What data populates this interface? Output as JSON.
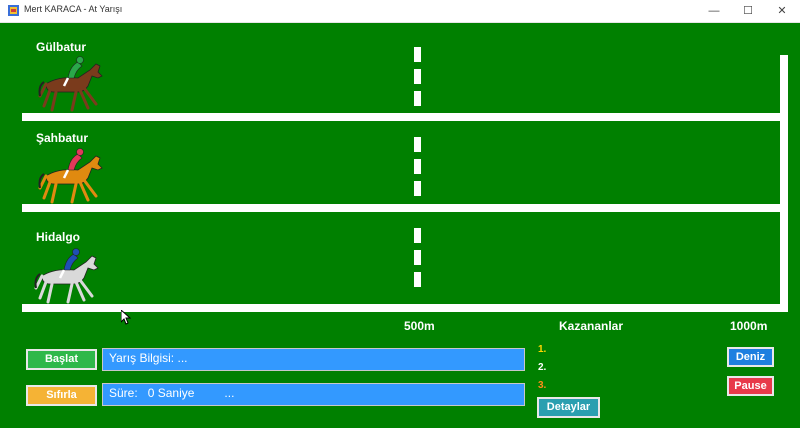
{
  "window": {
    "title": "Mert KARACA - At Yarışı",
    "min_symbol": "—",
    "max_symbol": "☐",
    "close_symbol": "✕"
  },
  "horses": [
    {
      "name": "Gülbatur",
      "jockey_color": "#2aa84a",
      "body_color": "#7a3b1c"
    },
    {
      "name": "Şahbatur",
      "jockey_color": "#e23a5a",
      "body_color": "#e08a10"
    },
    {
      "name": "Hidalgo",
      "jockey_color": "#1f4fb5",
      "body_color": "#d9d9d9"
    }
  ],
  "markers": {
    "mid": "500m",
    "winners_title": "Kazananlar",
    "finish": "1000m"
  },
  "buttons": {
    "start": "Başlat",
    "reset": "Sıfırla",
    "details": "Detaylar",
    "sea": "Deniz",
    "pause": "Pause"
  },
  "info": {
    "race_label": "Yarış Bilgisi:",
    "race_value": "...",
    "time_label": "Süre:",
    "time_value": "0 Saniye",
    "time_extra": "..."
  },
  "ranks": [
    {
      "label": "1.",
      "color": "#ffd700"
    },
    {
      "label": "2.",
      "color": "#ffffff"
    },
    {
      "label": "3.",
      "color": "#ff8c1a"
    }
  ],
  "colors": {
    "track": "#008000",
    "start_button": "#2eb84a",
    "reset_button": "#f5b335",
    "sea_button": "#1e7fe0",
    "pause_button": "#e83a4a",
    "details_button": "#2a9fb0",
    "info_box": "#3399ff"
  }
}
